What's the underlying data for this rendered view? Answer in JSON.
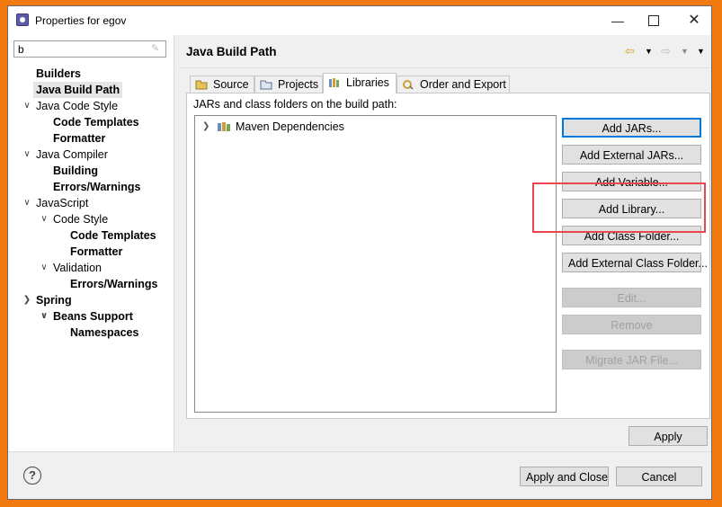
{
  "window": {
    "title": "Properties for egov",
    "minimize_icon": "minimize-icon",
    "maximize_icon": "maximize-icon",
    "close_icon": "close-icon"
  },
  "filter": {
    "value": "b"
  },
  "tree": [
    {
      "label": "Builders",
      "bold": true,
      "indent": 0,
      "expand": ""
    },
    {
      "label": "Java Build Path",
      "bold": true,
      "indent": 0,
      "expand": "",
      "selected": true
    },
    {
      "label": "Java Code Style",
      "bold": false,
      "indent": 0,
      "expand": "v"
    },
    {
      "label": "Code Templates",
      "bold": true,
      "indent": 1,
      "expand": ""
    },
    {
      "label": "Formatter",
      "bold": true,
      "indent": 1,
      "expand": ""
    },
    {
      "label": "Java Compiler",
      "bold": false,
      "indent": 0,
      "expand": "v"
    },
    {
      "label": "Building",
      "bold": true,
      "indent": 1,
      "expand": ""
    },
    {
      "label": "Errors/Warnings",
      "bold": true,
      "indent": 1,
      "expand": ""
    },
    {
      "label": "JavaScript",
      "bold": false,
      "indent": 0,
      "expand": "v"
    },
    {
      "label": "Code Style",
      "bold": false,
      "indent": 1,
      "expand": "v"
    },
    {
      "label": "Code Templates",
      "bold": true,
      "indent": 2,
      "expand": ""
    },
    {
      "label": "Formatter",
      "bold": true,
      "indent": 2,
      "expand": ""
    },
    {
      "label": "Validation",
      "bold": false,
      "indent": 1,
      "expand": "v"
    },
    {
      "label": "Errors/Warnings",
      "bold": true,
      "indent": 2,
      "expand": ""
    },
    {
      "label": "Spring",
      "bold": true,
      "indent": 0,
      "expand": ">"
    },
    {
      "label": "Beans Support",
      "bold": true,
      "indent": 1,
      "expand": "v"
    },
    {
      "label": "Namespaces",
      "bold": true,
      "indent": 2,
      "expand": ""
    }
  ],
  "page": {
    "title": "Java Build Path"
  },
  "tabs": [
    {
      "label": "Source",
      "active": false
    },
    {
      "label": "Projects",
      "active": false
    },
    {
      "label": "Libraries",
      "active": true
    },
    {
      "label": "Order and Export",
      "active": false
    }
  ],
  "libraries": {
    "heading": "JARs and class folders on the build path:",
    "items": [
      {
        "label": "Maven Dependencies"
      }
    ]
  },
  "buttons": {
    "add_jars": "Add JARs...",
    "add_external_jars": "Add External JARs...",
    "add_variable": "Add Variable...",
    "add_library": "Add Library...",
    "add_class_folder": "Add Class Folder...",
    "add_external_class_folder": "Add External Class Folder...",
    "edit": "Edit...",
    "remove": "Remove",
    "migrate_jar": "Migrate JAR File...",
    "apply": "Apply",
    "apply_and_close": "Apply and Close",
    "cancel": "Cancel"
  },
  "colors": {
    "highlight": "#e8464f",
    "frame": "#f07a10",
    "default_button_border": "#0078d7"
  }
}
